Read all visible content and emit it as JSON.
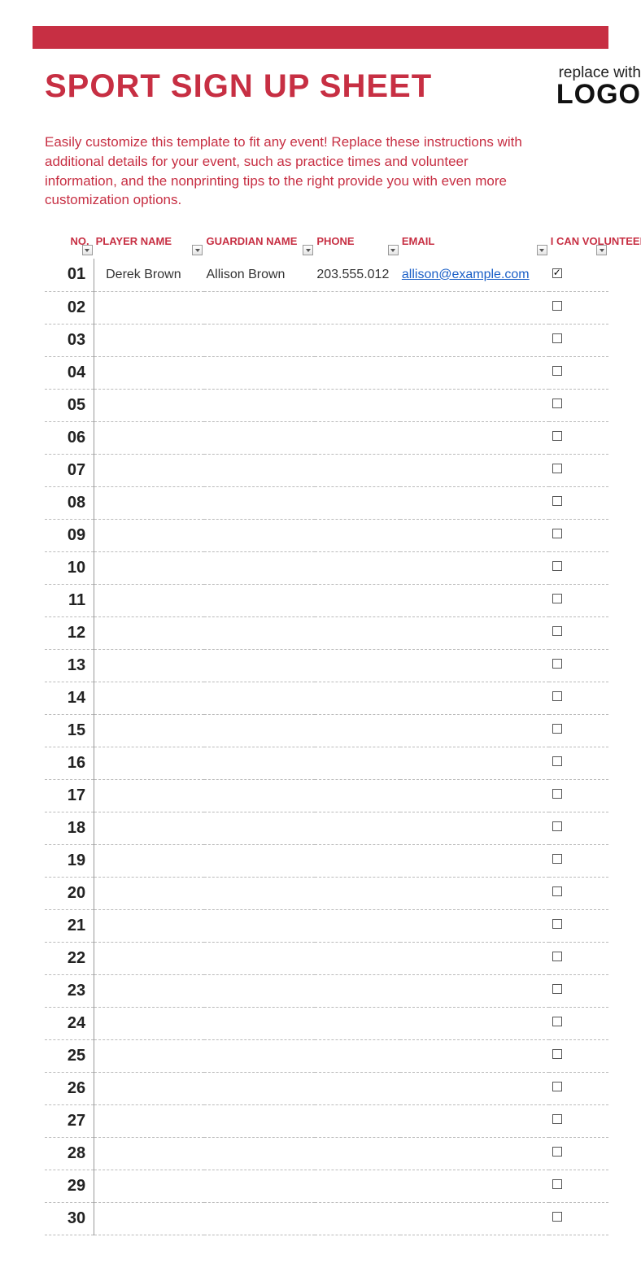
{
  "header": {
    "title": "SPORT SIGN UP SHEET",
    "logo_top": "replace with",
    "logo_bottom": "LOGO"
  },
  "description": "Easily customize this template to fit any event! Replace these instructions with additional details for your event, such as practice times and volunteer information, and the nonprinting tips to the right provide you with even more customization options.",
  "columns": {
    "no": "NO.",
    "player": "PLAYER NAME",
    "guardian": "GUARDIAN NAME",
    "phone": "PHONE",
    "email": "EMAIL",
    "volunteer": "I CAN VOLUNTEER"
  },
  "rows": [
    {
      "no": "01",
      "player": "Derek Brown",
      "guardian": "Allison Brown",
      "phone": "203.555.012",
      "email": "allison@example.com",
      "volunteer": true
    },
    {
      "no": "02",
      "player": "",
      "guardian": "",
      "phone": "",
      "email": "",
      "volunteer": false
    },
    {
      "no": "03",
      "player": "",
      "guardian": "",
      "phone": "",
      "email": "",
      "volunteer": false
    },
    {
      "no": "04",
      "player": "",
      "guardian": "",
      "phone": "",
      "email": "",
      "volunteer": false
    },
    {
      "no": "05",
      "player": "",
      "guardian": "",
      "phone": "",
      "email": "",
      "volunteer": false
    },
    {
      "no": "06",
      "player": "",
      "guardian": "",
      "phone": "",
      "email": "",
      "volunteer": false
    },
    {
      "no": "07",
      "player": "",
      "guardian": "",
      "phone": "",
      "email": "",
      "volunteer": false
    },
    {
      "no": "08",
      "player": "",
      "guardian": "",
      "phone": "",
      "email": "",
      "volunteer": false
    },
    {
      "no": "09",
      "player": "",
      "guardian": "",
      "phone": "",
      "email": "",
      "volunteer": false
    },
    {
      "no": "10",
      "player": "",
      "guardian": "",
      "phone": "",
      "email": "",
      "volunteer": false
    },
    {
      "no": "11",
      "player": "",
      "guardian": "",
      "phone": "",
      "email": "",
      "volunteer": false
    },
    {
      "no": "12",
      "player": "",
      "guardian": "",
      "phone": "",
      "email": "",
      "volunteer": false
    },
    {
      "no": "13",
      "player": "",
      "guardian": "",
      "phone": "",
      "email": "",
      "volunteer": false
    },
    {
      "no": "14",
      "player": "",
      "guardian": "",
      "phone": "",
      "email": "",
      "volunteer": false
    },
    {
      "no": "15",
      "player": "",
      "guardian": "",
      "phone": "",
      "email": "",
      "volunteer": false
    },
    {
      "no": "16",
      "player": "",
      "guardian": "",
      "phone": "",
      "email": "",
      "volunteer": false
    },
    {
      "no": "17",
      "player": "",
      "guardian": "",
      "phone": "",
      "email": "",
      "volunteer": false
    },
    {
      "no": "18",
      "player": "",
      "guardian": "",
      "phone": "",
      "email": "",
      "volunteer": false
    },
    {
      "no": "19",
      "player": "",
      "guardian": "",
      "phone": "",
      "email": "",
      "volunteer": false
    },
    {
      "no": "20",
      "player": "",
      "guardian": "",
      "phone": "",
      "email": "",
      "volunteer": false
    },
    {
      "no": "21",
      "player": "",
      "guardian": "",
      "phone": "",
      "email": "",
      "volunteer": false
    },
    {
      "no": "22",
      "player": "",
      "guardian": "",
      "phone": "",
      "email": "",
      "volunteer": false
    },
    {
      "no": "23",
      "player": "",
      "guardian": "",
      "phone": "",
      "email": "",
      "volunteer": false
    },
    {
      "no": "24",
      "player": "",
      "guardian": "",
      "phone": "",
      "email": "",
      "volunteer": false
    },
    {
      "no": "25",
      "player": "",
      "guardian": "",
      "phone": "",
      "email": "",
      "volunteer": false
    },
    {
      "no": "26",
      "player": "",
      "guardian": "",
      "phone": "",
      "email": "",
      "volunteer": false
    },
    {
      "no": "27",
      "player": "",
      "guardian": "",
      "phone": "",
      "email": "",
      "volunteer": false
    },
    {
      "no": "28",
      "player": "",
      "guardian": "",
      "phone": "",
      "email": "",
      "volunteer": false
    },
    {
      "no": "29",
      "player": "",
      "guardian": "",
      "phone": "",
      "email": "",
      "volunteer": false
    },
    {
      "no": "30",
      "player": "",
      "guardian": "",
      "phone": "",
      "email": "",
      "volunteer": false
    }
  ]
}
